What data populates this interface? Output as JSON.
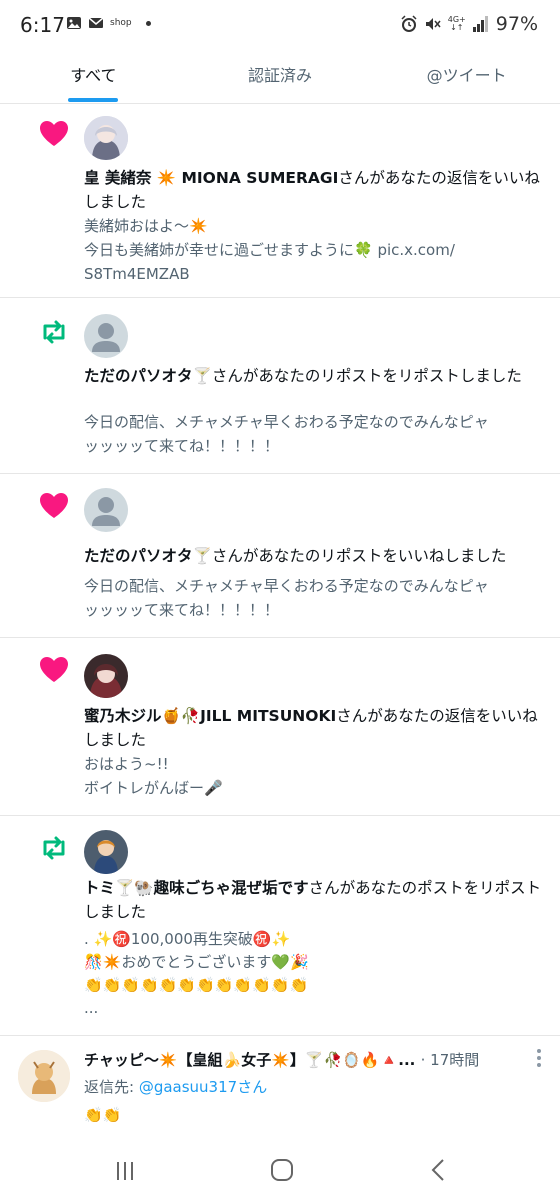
{
  "status_bar": {
    "time": "6:17",
    "shop_label": "shop",
    "battery_pct": "97%",
    "network": "4G+"
  },
  "tabs": [
    {
      "label": "すべて",
      "active": true
    },
    {
      "label": "認証済み",
      "active": false
    },
    {
      "label": "@ツイート",
      "active": false
    }
  ],
  "notifications": [
    {
      "type": "like",
      "user": "皇 美緒奈 ✴️ MIONA SUMERAGI",
      "action": "さんがあなたの返信をいいねしました",
      "content_lines": [
        "美緒姉おはよ〜✴️",
        "今日も美緒姉が幸せに過ごせますように🍀 pic.x.com/",
        "S8Tm4EMZAB"
      ]
    },
    {
      "type": "repost",
      "user": "ただのパソオタ🍸",
      "action": "さんがあなたのリポストをリポストしました",
      "content_lines": [
        "今日の配信、メチャメチャ早くおわる予定なのでみんなピャ",
        "ッッッッて来てね！！！！！"
      ]
    },
    {
      "type": "like",
      "user": "ただのパソオタ🍸",
      "action": "さんがあなたのリポストをいいねしました",
      "content_lines": [
        "今日の配信、メチャメチャ早くおわる予定なのでみんなピャ",
        "ッッッッて来てね！！！！！"
      ]
    },
    {
      "type": "like",
      "user": "蜜乃木ジル🍯🥀JILL MITSUNOKI",
      "action": "さんがあなたの返信をいいねしました",
      "content_lines": [
        "おはよう~!!",
        "ボイトレがんばー🎤"
      ]
    },
    {
      "type": "repost",
      "user": "トミ🍸🐏趣味ごちゃ混ぜ垢です",
      "action": "さんがあなたのポストをリポストしました",
      "content_lines": [
        ". ✨㊗️100,000再生突破㊗️✨",
        "🎊✴️おめでとうございます💚🎉",
        "👏👏👏👏👏👏👏👏👏👏👏👏",
        "..."
      ]
    }
  ],
  "tweet": {
    "header": "チャッピ〜✴️【皇組🍌女子✴️】🍸🥀🪞🔥🔺...",
    "time": "· 17時間",
    "reply_prefix": "返信先: ",
    "reply_handle": "@gaasuu317さん",
    "content": "👏👏"
  },
  "colors": {
    "like": "#f91880",
    "repost": "#00ba7c",
    "accent": "#1d9bf0",
    "muted": "#536471"
  },
  "icons": {
    "like": "heart-icon",
    "repost": "repost-icon",
    "more": "more-vertical-icon",
    "nav_recents": "recents-icon",
    "nav_home": "home-circle-icon",
    "nav_back": "back-chevron-icon"
  }
}
